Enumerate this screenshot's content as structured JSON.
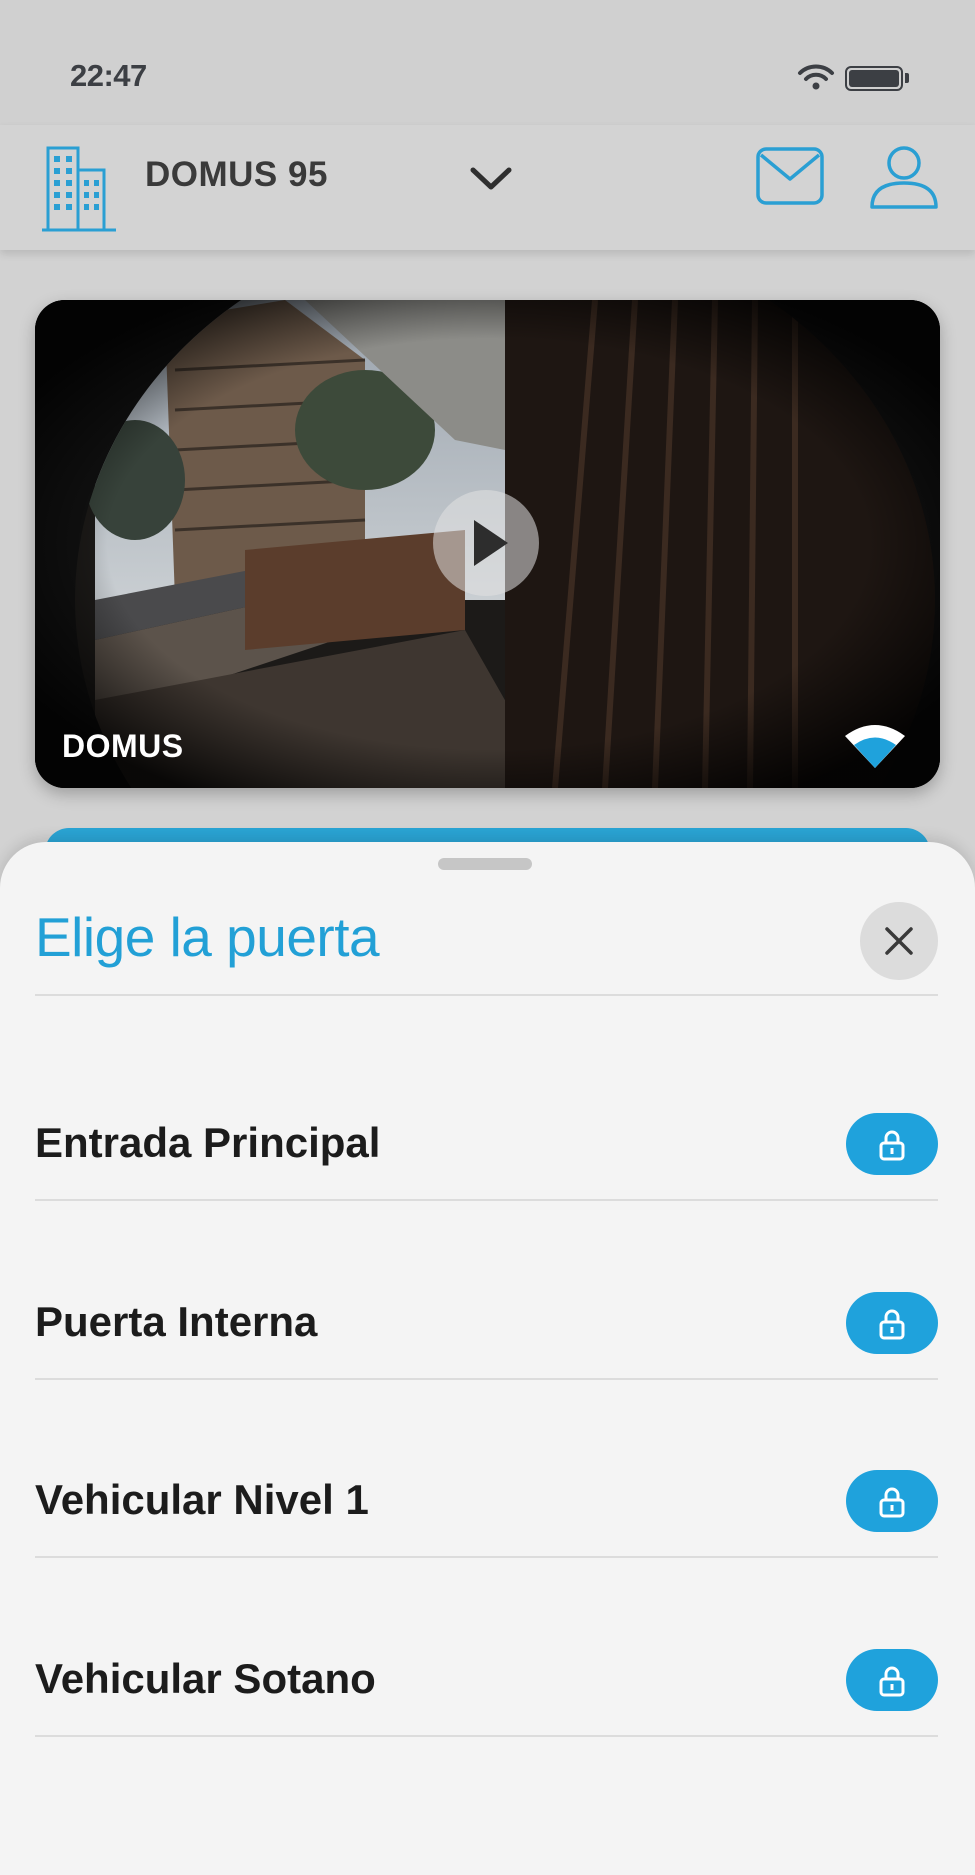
{
  "status_bar": {
    "time": "22:47",
    "icons": [
      "wifi-icon",
      "battery-icon"
    ]
  },
  "header": {
    "building_name": "DOMUS 95",
    "icons": [
      "building-icon",
      "chevron-down-icon",
      "mail-icon",
      "user-icon"
    ]
  },
  "camera": {
    "label": "DOMUS",
    "icons": [
      "play-icon",
      "signal-icon"
    ]
  },
  "sheet": {
    "title": "Elige la puerta",
    "close_icon": "close-icon",
    "doors": [
      {
        "name": "Entrada Principal",
        "icon": "lock-icon"
      },
      {
        "name": "Puerta Interna",
        "icon": "lock-icon"
      },
      {
        "name": "Vehicular Nivel 1",
        "icon": "lock-icon"
      },
      {
        "name": "Vehicular Sotano",
        "icon": "lock-icon"
      }
    ]
  },
  "colors": {
    "accent": "#1fa2dc",
    "title": "#22a0d6"
  }
}
